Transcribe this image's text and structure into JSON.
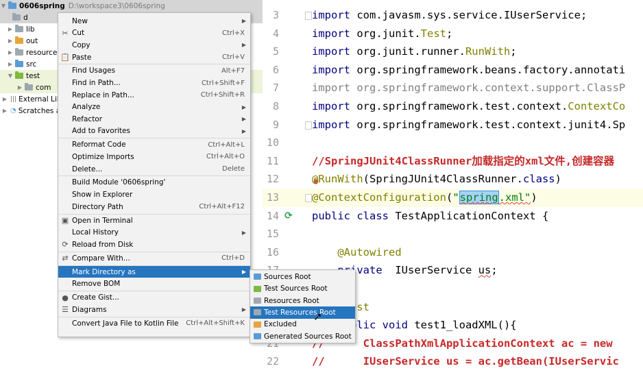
{
  "tree": {
    "project_name": "0606spring",
    "project_path": "D:\\workspace3\\0606spring",
    "items": [
      "d",
      "lib",
      "out",
      "resource",
      "src",
      "test",
      "com",
      "External Libr",
      "Scratches ar"
    ]
  },
  "editor": {
    "lines": [
      {
        "num": "3",
        "segments": [
          {
            "t": "import ",
            "c": "kw"
          },
          {
            "t": "com.javasm.sys.service.IUserService;",
            "c": ""
          }
        ]
      },
      {
        "num": "4",
        "segments": [
          {
            "t": "import ",
            "c": "kw"
          },
          {
            "t": "org.junit.",
            "c": ""
          },
          {
            "t": "Test",
            "c": "cls"
          },
          {
            "t": ";",
            "c": ""
          }
        ]
      },
      {
        "num": "5",
        "segments": [
          {
            "t": "import ",
            "c": "kw"
          },
          {
            "t": "org.junit.runner.",
            "c": ""
          },
          {
            "t": "RunWith",
            "c": "cls"
          },
          {
            "t": ";",
            "c": ""
          }
        ]
      },
      {
        "num": "6",
        "segments": [
          {
            "t": "import ",
            "c": "kw"
          },
          {
            "t": "org.springframework.beans.factory.annotati",
            "c": ""
          }
        ]
      },
      {
        "num": "7",
        "segments": [
          {
            "t": "import org.springframework.context.support.ClassP",
            "c": "gray"
          }
        ]
      },
      {
        "num": "8",
        "segments": [
          {
            "t": "import ",
            "c": "kw"
          },
          {
            "t": "org.springframework.test.context.",
            "c": ""
          },
          {
            "t": "ContextCo",
            "c": "cls"
          }
        ]
      },
      {
        "num": "9",
        "segments": [
          {
            "t": "import ",
            "c": "kw"
          },
          {
            "t": "org.springframework.test.context.junit4.Sp",
            "c": ""
          }
        ]
      },
      {
        "num": "10",
        "segments": []
      },
      {
        "num": "11",
        "segments": [
          {
            "t": "//SpringJUnit4ClassRunner加载指定的xml文件,创建容器",
            "c": "cm"
          }
        ]
      },
      {
        "num": "12",
        "segments": [
          {
            "t": "@RunWith",
            "c": "ann"
          },
          {
            "t": "(SpringJUnit4ClassRunner.",
            "c": ""
          },
          {
            "t": "class",
            "c": "kw"
          },
          {
            "t": ")",
            "c": ""
          }
        ]
      },
      {
        "num": "13",
        "segments": [
          {
            "t": "@ContextConfiguration",
            "c": "ann"
          },
          {
            "t": "(",
            "c": ""
          },
          {
            "t": "\"",
            "c": "str"
          },
          {
            "t": "spring",
            "c": "spring"
          },
          {
            "t": ".xml\"",
            "c": "strsq"
          },
          {
            "t": ")",
            "c": ""
          }
        ]
      },
      {
        "num": "14",
        "segments": [
          {
            "t": "public class ",
            "c": "kw"
          },
          {
            "t": "TestApplicationContext {",
            "c": ""
          }
        ]
      },
      {
        "num": "15",
        "segments": []
      },
      {
        "num": "16",
        "segments": [
          {
            "t": "    @Autowired",
            "c": "ann"
          }
        ]
      },
      {
        "num": "17",
        "segments": [
          {
            "t": "    private  ",
            "c": "kw"
          },
          {
            "t": "IUserService ",
            "c": ""
          },
          {
            "t": "us",
            "c": "sq"
          },
          {
            "t": ";",
            "c": ""
          }
        ]
      },
      {
        "num": "18",
        "segments": []
      },
      {
        "num": "19",
        "segments": [
          {
            "t": "    @Test",
            "c": "ann"
          }
        ]
      },
      {
        "num": "20",
        "segments": [
          {
            "t": "    public void ",
            "c": "kw"
          },
          {
            "t": "test1_loadXML(){",
            "c": ""
          }
        ]
      },
      {
        "num": "21",
        "segments": [
          {
            "t": "//      ClassPathXmlApplicationContext ac = new",
            "c": "cm"
          }
        ]
      },
      {
        "num": "22",
        "segments": [
          {
            "t": "//      IUserService us = ac.getBean(IUserServic",
            "c": "cm"
          }
        ]
      }
    ]
  },
  "menu": {
    "items": [
      {
        "label": "New",
        "shortcut": "",
        "sub": true,
        "icon": ""
      },
      {
        "label": "Cut",
        "shortcut": "Ctrl+X",
        "sub": false,
        "icon": "scissors-icon",
        "glyph": "✂"
      },
      {
        "label": "Copy",
        "shortcut": "",
        "sub": true,
        "icon": ""
      },
      {
        "label": "Paste",
        "shortcut": "Ctrl+V",
        "sub": false,
        "icon": "clipboard-icon",
        "glyph": "📋"
      },
      {
        "label": "Find Usages",
        "shortcut": "Alt+F7",
        "sub": false,
        "icon": ""
      },
      {
        "label": "Find in Path...",
        "shortcut": "Ctrl+Shift+F",
        "sub": false,
        "icon": ""
      },
      {
        "label": "Replace in Path...",
        "shortcut": "Ctrl+Shift+R",
        "sub": false,
        "icon": ""
      },
      {
        "label": "Analyze",
        "shortcut": "",
        "sub": true,
        "icon": ""
      },
      {
        "label": "Refactor",
        "shortcut": "",
        "sub": true,
        "icon": ""
      },
      {
        "label": "Add to Favorites",
        "shortcut": "",
        "sub": true,
        "icon": ""
      },
      {
        "label": "Reformat Code",
        "shortcut": "Ctrl+Alt+L",
        "sub": false,
        "icon": ""
      },
      {
        "label": "Optimize Imports",
        "shortcut": "Ctrl+Alt+O",
        "sub": false,
        "icon": ""
      },
      {
        "label": "Delete...",
        "shortcut": "Delete",
        "sub": false,
        "icon": ""
      },
      {
        "label": "Build Module '0606spring'",
        "shortcut": "",
        "sub": false,
        "icon": ""
      },
      {
        "label": "Show in Explorer",
        "shortcut": "",
        "sub": false,
        "icon": ""
      },
      {
        "label": "Directory Path",
        "shortcut": "Ctrl+Alt+F12",
        "sub": false,
        "icon": ""
      },
      {
        "label": "Open in Terminal",
        "shortcut": "",
        "sub": false,
        "icon": "terminal-icon",
        "glyph": "▣"
      },
      {
        "label": "Local History",
        "shortcut": "",
        "sub": true,
        "icon": ""
      },
      {
        "label": "Reload from Disk",
        "shortcut": "",
        "sub": false,
        "icon": "reload-icon",
        "glyph": "⟳"
      },
      {
        "label": "Compare With...",
        "shortcut": "Ctrl+D",
        "sub": false,
        "icon": "compare-icon",
        "glyph": "⇄"
      },
      {
        "label": "Mark Directory as",
        "shortcut": "",
        "sub": true,
        "icon": "",
        "active": true
      },
      {
        "label": "Remove BOM",
        "shortcut": "",
        "sub": false,
        "icon": ""
      },
      {
        "label": "Create Gist...",
        "shortcut": "",
        "sub": false,
        "icon": "github-icon",
        "glyph": "●"
      },
      {
        "label": "Diagrams",
        "shortcut": "",
        "sub": true,
        "icon": "diagram-icon",
        "glyph": "☰"
      },
      {
        "label": "Convert Java File to Kotlin File",
        "shortcut": "Ctrl+Alt+Shift+K",
        "sub": false,
        "icon": ""
      }
    ]
  },
  "submenu": {
    "items": [
      {
        "label": "Sources Root",
        "color": "#5b9bd5"
      },
      {
        "label": "Test Sources Root",
        "color": "#7fb843"
      },
      {
        "label": "Resources Root",
        "color": "#a0a8b0"
      },
      {
        "label": "Test Resources Root",
        "color": "#a0a8b0",
        "active": true
      },
      {
        "label": "Excluded",
        "color": "#e8a43f"
      },
      {
        "label": "Generated Sources Root",
        "color": "#5b9bd5"
      }
    ]
  }
}
